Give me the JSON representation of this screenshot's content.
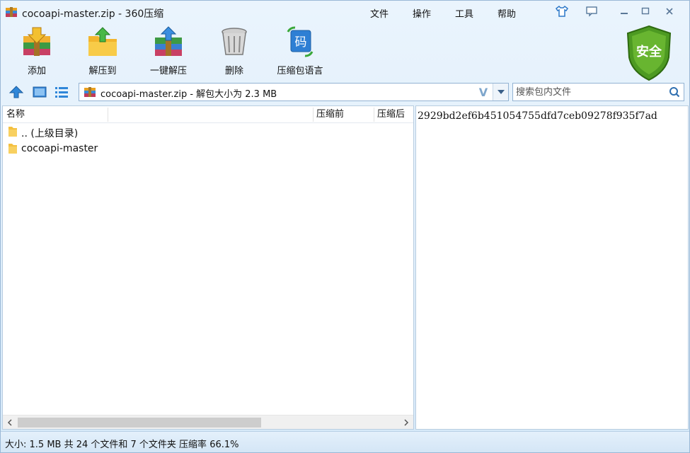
{
  "window": {
    "title": "cocoapi-master.zip - 360压缩"
  },
  "menu": [
    "文件",
    "操作",
    "工具",
    "帮助"
  ],
  "toolbar": {
    "add": "添加",
    "extract_to": "解压到",
    "one_click_extract": "一键解压",
    "delete": "删除",
    "archive_language": "压缩包语言",
    "language_icon_char": "码"
  },
  "badge": {
    "label": "安全",
    "color": "#5aa52a"
  },
  "address": {
    "path_text": "cocoapi-master.zip - 解包大小为 2.3 MB",
    "v_mark": "V"
  },
  "search": {
    "placeholder": "搜索包内文件"
  },
  "columns": {
    "name": "名称",
    "before": "压缩前",
    "after": "压缩后"
  },
  "files": [
    {
      "name": ".. (上级目录)"
    },
    {
      "name": "cocoapi-master"
    }
  ],
  "comment": "2929bd2ef6b451054755dfd7ceb09278f935f7ad",
  "status": "大小: 1.5 MB 共 24 个文件和 7 个文件夹 压缩率 66.1%"
}
